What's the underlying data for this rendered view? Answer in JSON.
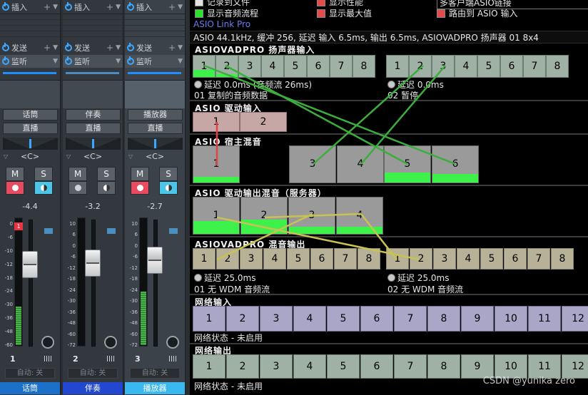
{
  "mixer": {
    "insert_label": "插入",
    "send_label": "发送",
    "listen_label": "监听",
    "channels": [
      {
        "index": "1",
        "name": "话筒",
        "input": "话筒",
        "mode": "直播",
        "pan": "<C>",
        "mute": "M",
        "solo": "S",
        "volume": "-4.4",
        "auto": "自动: 关",
        "peak": "1",
        "meter_level": 0.3
      },
      {
        "index": "2",
        "name": "伴奏",
        "input": "伴奏",
        "mode": "直播",
        "pan": "<C>",
        "mute": "M",
        "solo": "S",
        "volume": "-3.2",
        "auto": "自动: 关",
        "meter_level": 0.0
      },
      {
        "index": "3",
        "name": "播放器",
        "input": "播放器",
        "mode": "直播",
        "pan": "<C>",
        "mute": "M",
        "solo": "S",
        "volume": "-2.7",
        "auto": "自动: 关",
        "meter_level": 0.42
      }
    ],
    "scale": [
      "0",
      "-6",
      "-10",
      "-12",
      "-18",
      "-24",
      "-30",
      "-36",
      "-48",
      "-60"
    ],
    "scale2": [
      "10",
      "6",
      "0",
      "-6",
      "-12",
      "-18",
      "-24",
      "-30",
      "-36",
      "-48",
      "-60",
      "-72"
    ]
  },
  "asio": {
    "options": {
      "record_to_file": "记录到文件",
      "show_audio_flow": "显示音频流程",
      "show_performance": "显示性能",
      "show_max": "显示最大值",
      "multi_client": "多客户端ASIO链接",
      "route_to_asio": "路由到 ASIO 输入"
    },
    "product": "ASIO Link Pro",
    "status": "ASIO 44.1kHz, 缓冲 256, 延迟 输入 6.5ms, 输出 6.5ms, ASIOVADPRO 扬声器 01 8x4",
    "sections": {
      "speaker_input": {
        "title": "ASIOVADPRO 扬声器输入",
        "group1": [
          "1",
          "2",
          "3",
          "4",
          "5",
          "6",
          "7",
          "8"
        ],
        "group2": [
          "1",
          "2",
          "3",
          "4",
          "5",
          "6",
          "7",
          "8"
        ],
        "latency1": "延迟 0.0ms (音频流 26ms)",
        "latency2": "延迟 0.0ms",
        "device1": "01 复制的音频数据",
        "device2": "02 暂停"
      },
      "driver_input": {
        "title": "ASIO 驱动输入",
        "channels": [
          "1",
          "2"
        ]
      },
      "host_mix": {
        "title": "ASIO 宿主混音",
        "channels": [
          "1",
          "3",
          "4",
          "5",
          "6"
        ]
      },
      "driver_output_mix": {
        "title": "ASIO 驱动输出混音（服务器）",
        "channels": [
          "1",
          "2",
          "3",
          "4"
        ]
      },
      "mix_output": {
        "title": "ASIOVADPRO 混音输出",
        "group1": [
          "1",
          "2",
          "3",
          "4",
          "5",
          "6",
          "7",
          "8"
        ],
        "group2": [
          "1",
          "2",
          "3",
          "4",
          "5",
          "6",
          "7",
          "8"
        ],
        "latency1": "延迟 25.0ms",
        "latency2": "延迟 25.0ms",
        "device1": "01 无 WDM 音频流",
        "device2": "02 无 WDM 音频流"
      },
      "network_input": {
        "title": "网络输入",
        "channels": [
          "1",
          "2",
          "3",
          "4",
          "5",
          "6",
          "7",
          "8",
          "9",
          "10",
          "11",
          "12"
        ],
        "state": "网络状态 - 未启用"
      },
      "network_output": {
        "title": "网络输出",
        "channels": [
          "1",
          "2",
          "3",
          "4",
          "5",
          "6",
          "7",
          "8",
          "9",
          "10",
          "11",
          "12"
        ],
        "state": "网络状态 - 未启用"
      }
    },
    "watermark": "CSDN @yunika zero"
  }
}
